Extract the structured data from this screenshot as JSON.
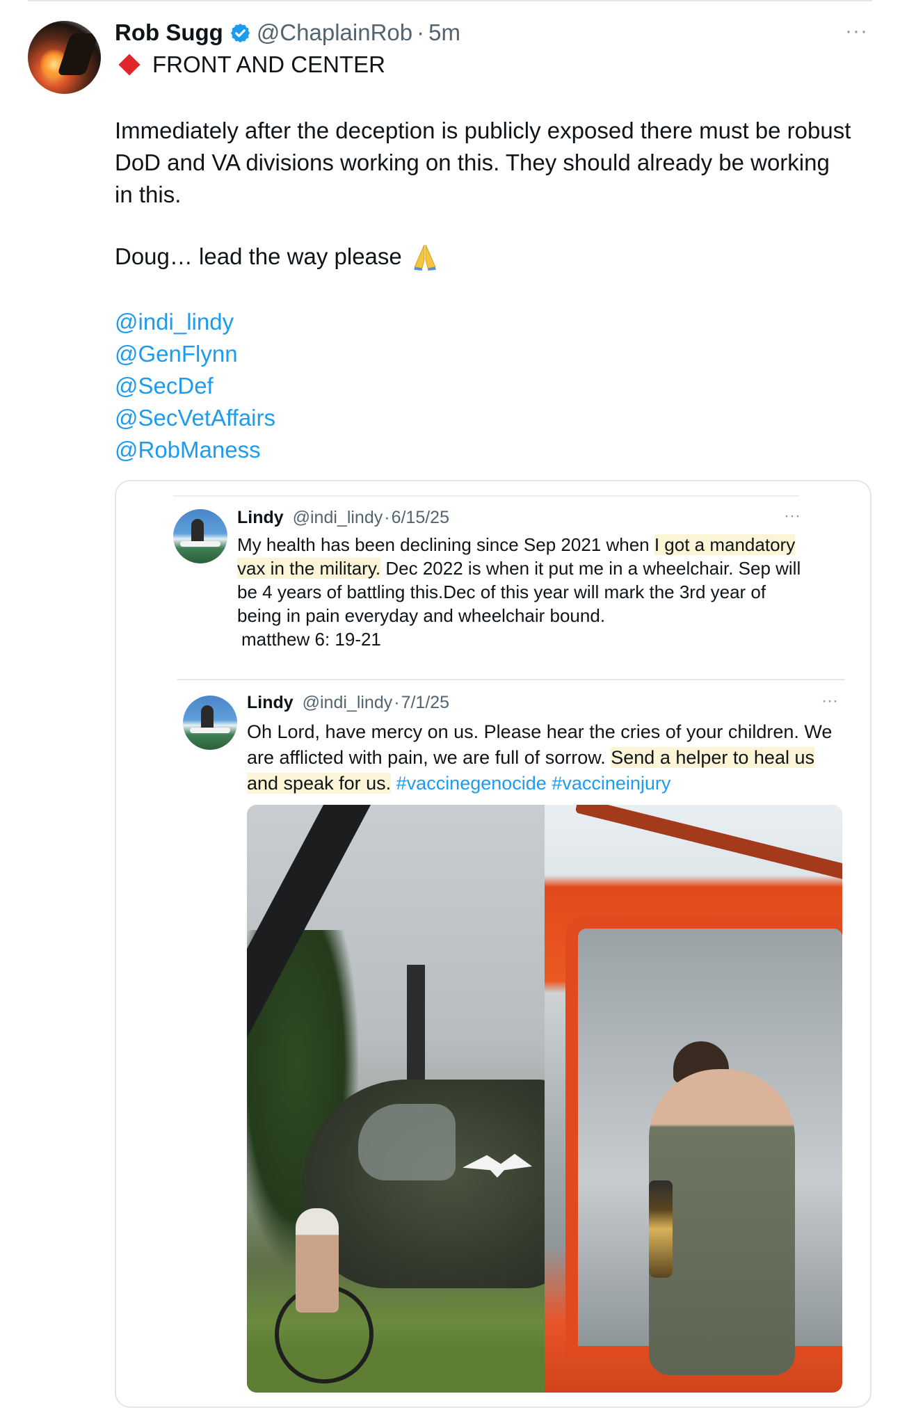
{
  "tweet": {
    "author_name": "Rob Sugg",
    "author_handle": "@ChaplainRob",
    "separator": "·",
    "time": "5m",
    "more": "···",
    "banner_text": "FRONT AND CENTER",
    "paragraph": "Immediately after the deception is publicly exposed there must be robust DoD and VA divisions working on this. They should already be working in this.",
    "doug_line": "Doug… lead the way please",
    "mentions": [
      "@indi_lindy",
      "@GenFlynn",
      "@SecDef",
      "@SecVetAffairs",
      "@RobManess"
    ],
    "colors": {
      "link": "#1d9bf0",
      "verified": "#1d9bf0",
      "diamond": "#e0252b",
      "highlight": "#fbf4d6"
    }
  },
  "quoted_1": {
    "author_name": "Lindy",
    "author_handle": "@indi_lindy",
    "separator": "·",
    "date": "6/15/25",
    "more": "···",
    "text_before": "My health has been declining since Sep 2021 when ",
    "text_highlight": "I got a mandatory vax in the military.",
    "text_after": " Dec 2022 is when it put me in a wheelchair. Sep will be 4 years of battling this.Dec of this year will mark the 3rd year of being in pain everyday and wheelchair bound.",
    "verse": "matthew 6: 19-21"
  },
  "quoted_2": {
    "author_name": "Lindy",
    "author_handle": "@indi_lindy",
    "separator": "·",
    "date": "7/1/25",
    "more": "···",
    "text_before": "Oh Lord, have mercy on us. Please hear the cries of your children. We are afflicted with pain, we are full of sorrow. ",
    "text_highlight": "Send a helper to heal us and speak for us.",
    "hashtags": [
      "#vaccinegenocide",
      "#vaccineinjury"
    ]
  }
}
